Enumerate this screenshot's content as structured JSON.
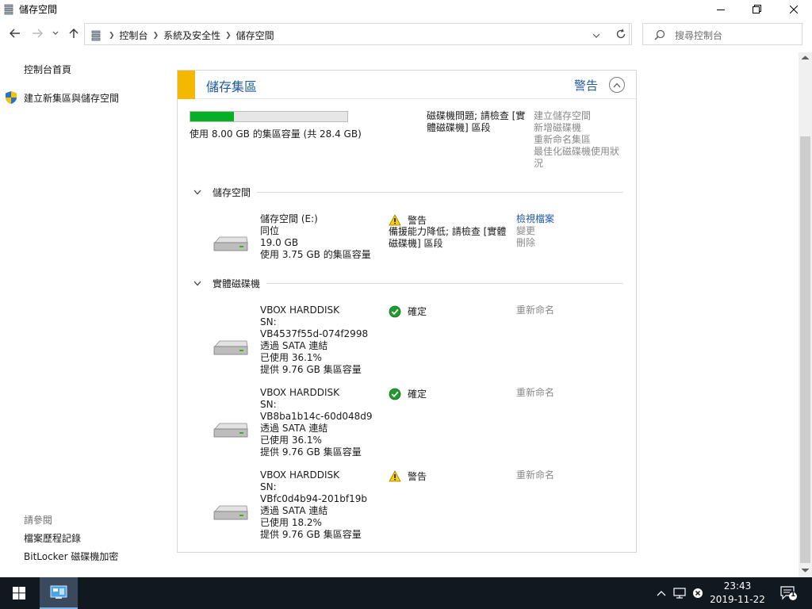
{
  "window": {
    "title": "儲存空間"
  },
  "nav": {
    "breadcrumb": [
      "控制台",
      "系統及安全性",
      "儲存空間"
    ],
    "search_placeholder": "搜尋控制台"
  },
  "left_pane": {
    "home": "控制台首頁",
    "create_pool": "建立新集區與儲存空間",
    "see_also": "請參閱",
    "links": [
      "檔案歷程記錄",
      "BitLocker 磁碟機加密"
    ]
  },
  "pool": {
    "title": "儲存集區",
    "status": "警告",
    "usage_fraction": 0.28,
    "usage_text": "使用 8.00 GB 的集區容量 (共 28.4 GB)",
    "message": "磁碟機問題; 請檢查 [實體磁碟機] 區段",
    "actions": [
      "建立儲存空間",
      "新增磁碟機",
      "重新命名集區",
      "最佳化磁碟機使用狀況"
    ],
    "spaces_header": "儲存空間",
    "space": {
      "name": "儲存空間 (E:)",
      "resiliency": "同位",
      "size": "19.0 GB",
      "usage": "使用 3.75 GB 的集區容量",
      "status": "警告",
      "desc": "備援能力降低; 請檢查 [實體磁碟機] 區段",
      "actions": [
        "檢視檔案",
        "變更",
        "刪除"
      ]
    },
    "drives_header": "實體磁碟機",
    "drives": [
      {
        "name": "VBOX HARDDISK",
        "sn_label": "SN:",
        "sn": "VB4537f55d-074f2998",
        "conn": "透過 SATA 連結",
        "used": "已使用 36.1%",
        "capacity": "提供 9.76 GB 集區容量",
        "status": "確定",
        "status_icon": "ok-icon",
        "action": "重新命名"
      },
      {
        "name": "VBOX HARDDISK",
        "sn_label": "SN:",
        "sn": "VB8ba1b14c-60d048d9",
        "conn": "透過 SATA 連結",
        "used": "已使用 36.1%",
        "capacity": "提供 9.76 GB 集區容量",
        "status": "確定",
        "status_icon": "ok-icon",
        "action": "重新命名"
      },
      {
        "name": "VBOX HARDDISK",
        "sn_label": "SN:",
        "sn": "VBfc0d4b94-201bf19b",
        "conn": "透過 SATA 連結",
        "used": "已使用 18.2%",
        "capacity": "提供 9.76 GB 集區容量",
        "status": "警告",
        "status_icon": "warning-icon",
        "action": "重新命名"
      }
    ]
  },
  "taskbar": {
    "time": "23:43",
    "date": "2019-11-22",
    "notifications": "1"
  },
  "colors": {
    "accent": "#f5b800",
    "link": "#1e5a9f",
    "progress": "#06b025",
    "taskbar": "#101820"
  }
}
